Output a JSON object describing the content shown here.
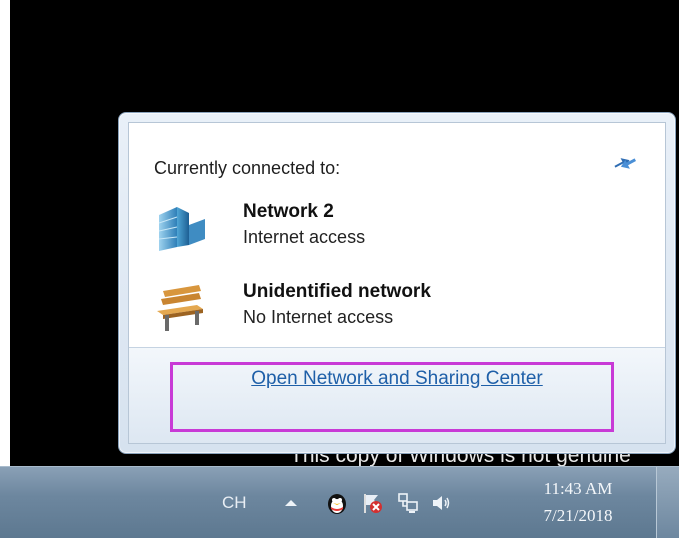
{
  "flyout": {
    "heading": "Currently connected to:",
    "networks": [
      {
        "name": "Network  2",
        "status": "Internet access",
        "icon": "network-domain-icon"
      },
      {
        "name": "Unidentified network",
        "status": "No Internet access",
        "icon": "park-bench-icon"
      }
    ],
    "open_link": "Open Network and Sharing Center",
    "highlight_color": "#c83ad6",
    "link_color": "#1e5fa8"
  },
  "watermark": "This copy of Windows is not genuine",
  "taskbar": {
    "language": "CH",
    "clock_time": "11:43 AM",
    "clock_date": "7/21/2018",
    "tray_icons": [
      "qq-penguin-icon",
      "action-center-flag-icon",
      "network-icon",
      "volume-icon"
    ]
  }
}
